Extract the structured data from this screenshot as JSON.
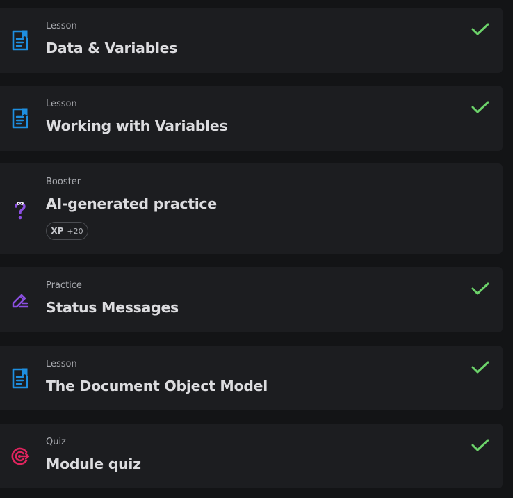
{
  "items": [
    {
      "kind": "Lesson",
      "title": "Data & Variables",
      "icon": "lesson-icon",
      "completed": true
    },
    {
      "kind": "Lesson",
      "title": "Working with Variables",
      "icon": "lesson-icon",
      "completed": true
    },
    {
      "kind": "Booster",
      "title": "AI-generated practice",
      "icon": "question-icon",
      "completed": false,
      "badge": {
        "label": "XP",
        "value": "+20"
      }
    },
    {
      "kind": "Practice",
      "title": "Status Messages",
      "icon": "pencil-icon",
      "completed": true
    },
    {
      "kind": "Lesson",
      "title": "The Document Object Model",
      "icon": "lesson-icon",
      "completed": true
    },
    {
      "kind": "Quiz",
      "title": "Module quiz",
      "icon": "target-icon",
      "completed": true
    }
  ],
  "colors": {
    "background": "#131416",
    "card": "#1c1d20",
    "lesson_icon": "#1e8fe0",
    "booster_icon": "#8b4fe0",
    "practice_icon": "#8b4fe0",
    "quiz_icon": "#e0245e",
    "check": "#6cd36a"
  }
}
